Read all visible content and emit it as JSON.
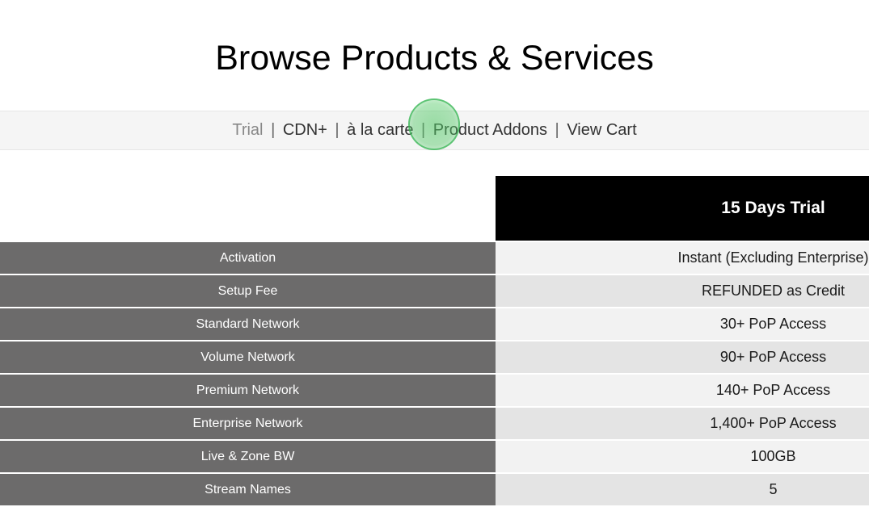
{
  "title": "Browse Products & Services",
  "nav": {
    "trial": "Trial",
    "cdn_plus": "CDN+",
    "a_la_carte": "à la carte",
    "product_addons": "Product Addons",
    "view_cart": "View Cart",
    "separator": "|"
  },
  "table": {
    "column_header": "15 Days Trial",
    "rows": [
      {
        "label": "Activation",
        "value": "Instant (Excluding Enterprise)"
      },
      {
        "label": "Setup Fee",
        "value": "REFUNDED as Credit"
      },
      {
        "label": "Standard Network",
        "value": "30+ PoP Access"
      },
      {
        "label": "Volume Network",
        "value": "90+ PoP Access"
      },
      {
        "label": "Premium Network",
        "value": "140+ PoP Access"
      },
      {
        "label": "Enterprise Network",
        "value": "1,400+ PoP Access"
      },
      {
        "label": "Live & Zone BW",
        "value": "100GB"
      },
      {
        "label": "Stream Names",
        "value": "5"
      }
    ]
  }
}
